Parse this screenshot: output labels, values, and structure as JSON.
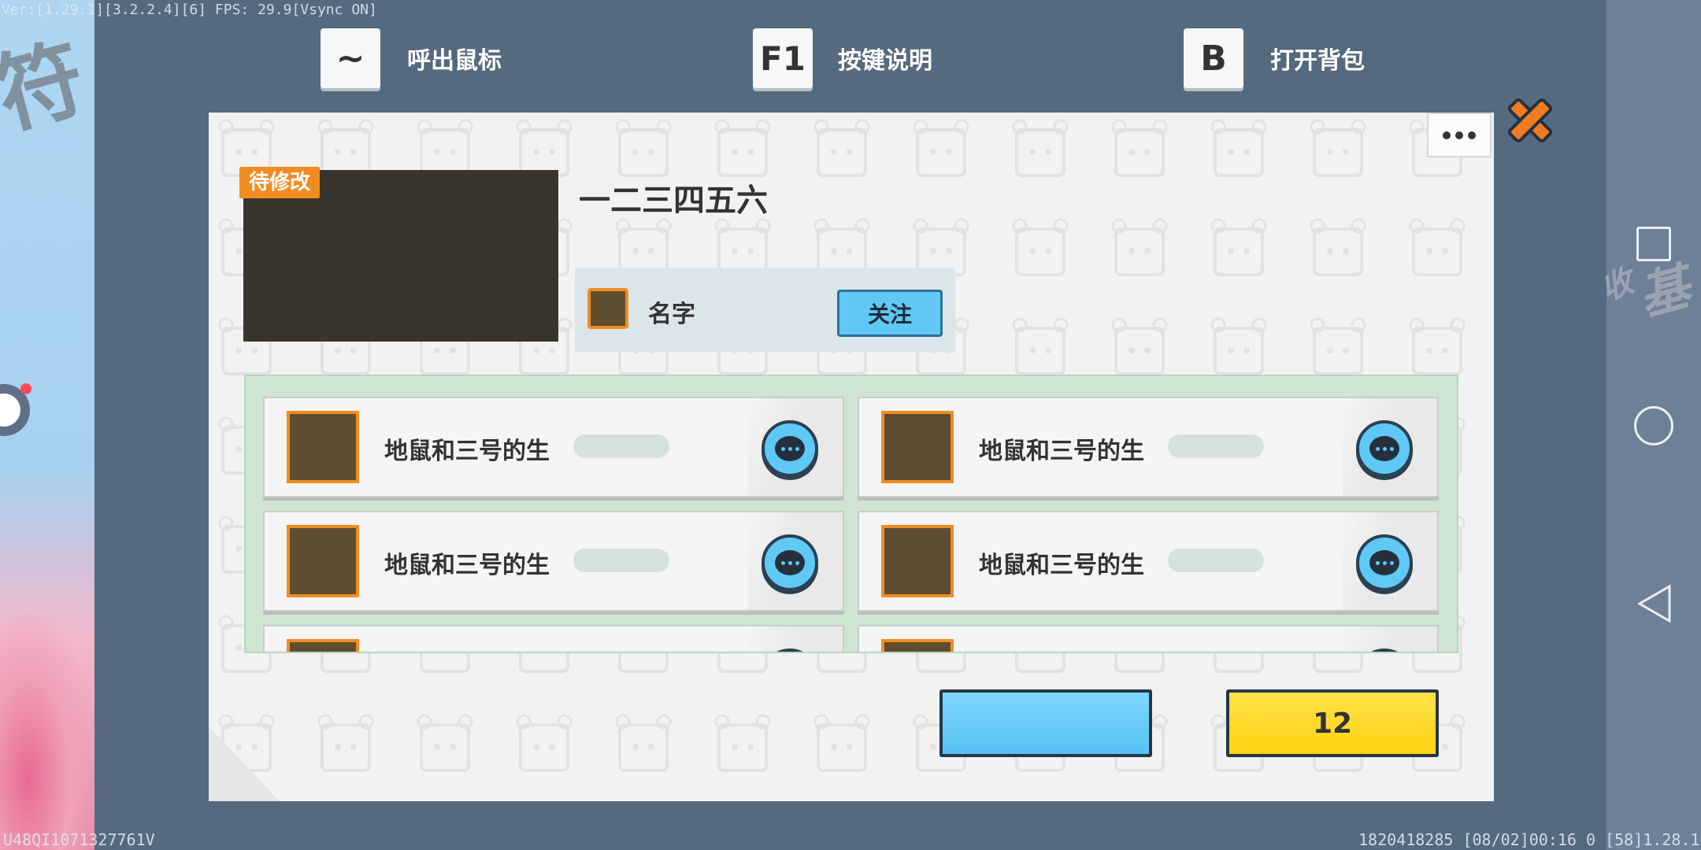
{
  "hud": {
    "debug_top": "Ver:[1.29.1][3.2.2.4][6] FPS: 29.9[Vsync ON]",
    "debug_bottom_left": "U48QI1071327761V",
    "debug_bottom_right": "1820418285    [08/02]00:16 0    [58]1.28.1"
  },
  "key_hints": [
    {
      "key": "~",
      "label": "呼出鼠标"
    },
    {
      "key": "F1",
      "label": "按键说明"
    },
    {
      "key": "B",
      "label": "打开背包"
    }
  ],
  "dialog": {
    "badge": "待修改",
    "title": "一二三四五六",
    "author": {
      "name": "名字",
      "follow_label": "关注"
    },
    "list_items": [
      {
        "name": "地鼠和三号的生"
      },
      {
        "name": "地鼠和三号的生"
      },
      {
        "name": "地鼠和三号的生"
      },
      {
        "name": "地鼠和三号的生"
      },
      {
        "name": ""
      },
      {
        "name": ""
      }
    ],
    "primary_button_label": "",
    "yellow_button_label": "12"
  },
  "colors": {
    "accent_orange": "#f08c21",
    "button_blue": "#5fc8f5",
    "button_yellow": "#ffd30f",
    "frame_bg": "#55697f"
  },
  "icons": [
    "tilde-key-icon",
    "f1-key-icon",
    "b-key-icon",
    "more-icon",
    "close-icon",
    "chat-icon",
    "square-nav-icon",
    "circle-nav-icon",
    "back-nav-icon"
  ]
}
